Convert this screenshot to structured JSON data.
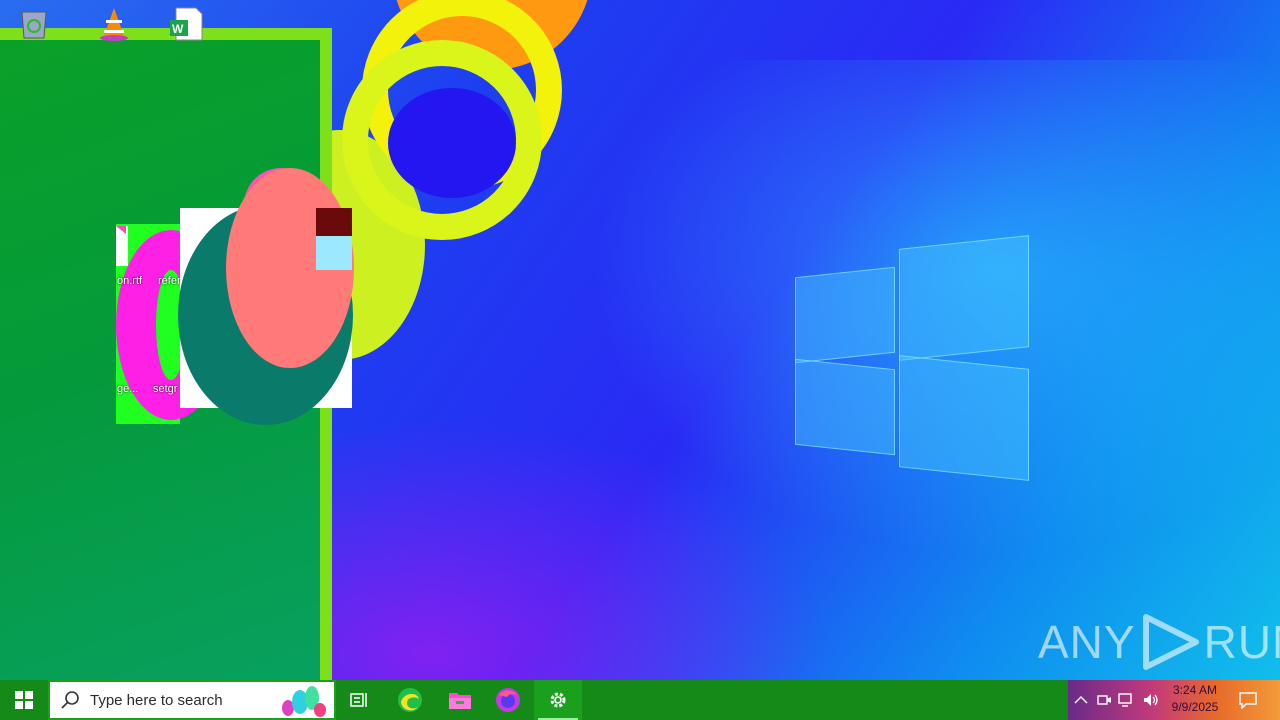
{
  "desktop": {
    "icons": [
      {
        "label": "on.rtf",
        "icon": "rtf-file-icon"
      },
      {
        "label": "refer",
        "icon": "word-document-icon"
      },
      {
        "label": "ge...",
        "icon": "file-icon"
      },
      {
        "label": "setgr",
        "icon": "word-document-icon"
      }
    ],
    "watermark": {
      "left": "ANY",
      "right": "RUN"
    }
  },
  "taskbar": {
    "search_placeholder": "Type here to search",
    "apps": [
      {
        "name": "task-view",
        "icon": "task-view-icon"
      },
      {
        "name": "edge",
        "icon": "edge-icon"
      },
      {
        "name": "file-explorer",
        "icon": "folder-icon"
      },
      {
        "name": "firefox",
        "icon": "firefox-icon"
      },
      {
        "name": "settings",
        "icon": "gear-icon"
      }
    ],
    "clock": {
      "time": "3:24 AM",
      "date": "9/9/2025"
    }
  },
  "colors": {
    "taskbar": "#168a18",
    "window_frame": "#7de01a",
    "window_body": "#049a3c"
  }
}
